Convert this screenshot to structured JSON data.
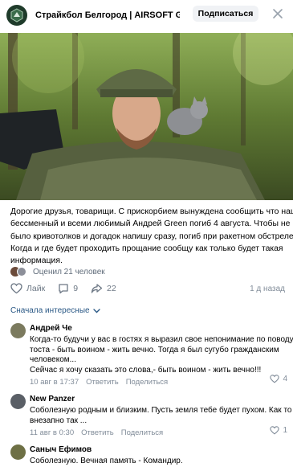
{
  "header": {
    "group_name": "Страйкбол Белгород | AIRSOFT GAME |",
    "subscribe_label": "Подписаться"
  },
  "post": {
    "text_lines": [
      "Дорогие друзья, товарищи. С прискорбием вынуждена сообщить что наш",
      "бессменный и всеми любимый Андрей Green погиб 4 августа. Чтобы не",
      "было кривотолков и догадок напишу сразу, погиб при ракетном обстреле.",
      "Когда и где будет проходить прощание сообщу как только будет такая",
      "информация."
    ],
    "rated_text": "Оценил 21 человек",
    "like_label": "Лайк",
    "comments_count": "9",
    "shares_count": "22",
    "posted_ago": "1 д назад"
  },
  "comments_sort": "Сначала интересные",
  "comments": [
    {
      "author": "Андрей Че",
      "lines": [
        "Когда-то будучи у вас в гостях я выразил свое непонимание по поводу",
        "тоста - быть воином - жить вечно. Тогда я был сугубо гражданским",
        "человеком...",
        "Сейчас я хочу сказать это слова,- быть воином - жить вечно!!!"
      ],
      "date": "10 авг в 17:37",
      "reply_label": "Ответить",
      "share_label": "Поделиться",
      "likes": "4"
    },
    {
      "author": "New Panzer",
      "lines": [
        "Соболезную родным и близким. Пусть земля тебе будет пухом. Как то",
        "внезапно так ..."
      ],
      "date": "11 авг в 0:30",
      "reply_label": "Ответить",
      "share_label": "Поделиться",
      "likes": "1"
    },
    {
      "author": "Саныч Ефимов",
      "lines": [
        "Соболезную. Вечная память - Командир."
      ]
    }
  ],
  "colors": {
    "link": "#2a5885",
    "muted": "#818c99",
    "button_bg": "#f0f2f5"
  }
}
